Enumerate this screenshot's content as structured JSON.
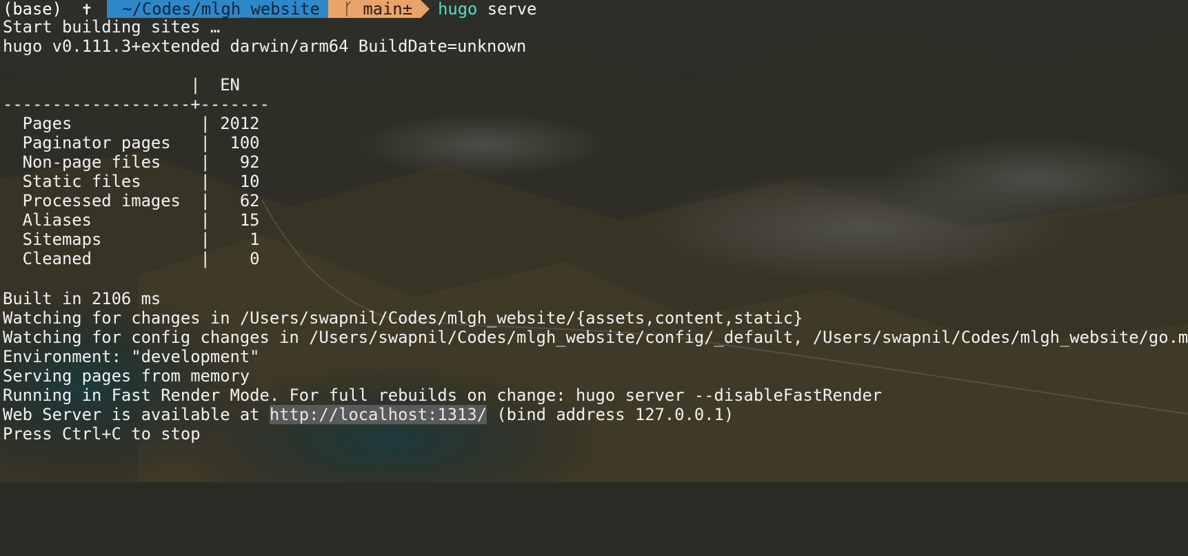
{
  "prompt": {
    "env": "(base)",
    "symbol": "✝",
    "dir": "~/Codes/mlgh_website",
    "git": "ᚴ main±",
    "command_name": "hugo",
    "command_args": " serve"
  },
  "output": {
    "l1": "Start building sites …",
    "l2": "hugo v0.111.3+extended darwin/arm64 BuildDate=unknown",
    "table_header": "                   |  EN",
    "table_sep": "-------------------+-------",
    "rows": [
      "  Pages             | 2012",
      "  Paginator pages   |  100",
      "  Non-page files    |   92",
      "  Static files      |   10",
      "  Processed images  |   62",
      "  Aliases           |   15",
      "  Sitemaps          |    1",
      "  Cleaned           |    0"
    ],
    "built": "Built in 2106 ms",
    "watching": "Watching for changes in /Users/swapnil/Codes/mlgh_website/{assets,content,static}",
    "watching_config": "Watching for config changes in /Users/swapnil/Codes/mlgh_website/config/_default, /Users/swapnil/Codes/mlgh_website/go.mod",
    "environment": "Environment: \"development\"",
    "serving": "Serving pages from memory",
    "fast_render": "Running in Fast Render Mode. For full rebuilds on change: hugo server --disableFastRender",
    "web_server_prefix": "Web Server is available at ",
    "web_server_url": "http://localhost:1313/",
    "web_server_suffix": " (bind address 127.0.0.1)",
    "stop": "Press Ctrl+C to stop"
  }
}
